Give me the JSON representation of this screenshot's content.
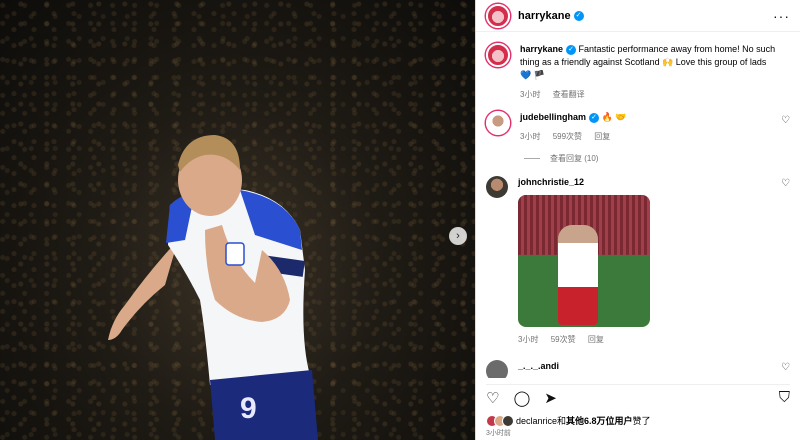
{
  "post": {
    "author": "harrykane",
    "caption_user": "harrykane",
    "caption_text": "Fantastic performance away from home! No such thing as a friendly against Scotland 🙌 Love this group of lads",
    "caption_emoji": "💙 🏴",
    "caption_time": "3小时",
    "translate": "查看翻译"
  },
  "comments": [
    {
      "user": "judebellingham",
      "text": "🔥 🤝",
      "time": "3小时",
      "likes": "599次赞",
      "reply": "回复",
      "view_replies": "查看回复 (10)"
    },
    {
      "user": "johnchristie_12",
      "time": "3小时",
      "likes": "59次赞",
      "reply": "回复"
    },
    {
      "user": "_._._.andi"
    }
  ],
  "likes_text_prefix": "declanrice和",
  "likes_text_bold": "其他6.8万位用户",
  "likes_text_suffix": "赞了",
  "posted_time": "3小时前",
  "colors": {
    "accent": "#0095f6",
    "story_ring": "#e1306c"
  }
}
